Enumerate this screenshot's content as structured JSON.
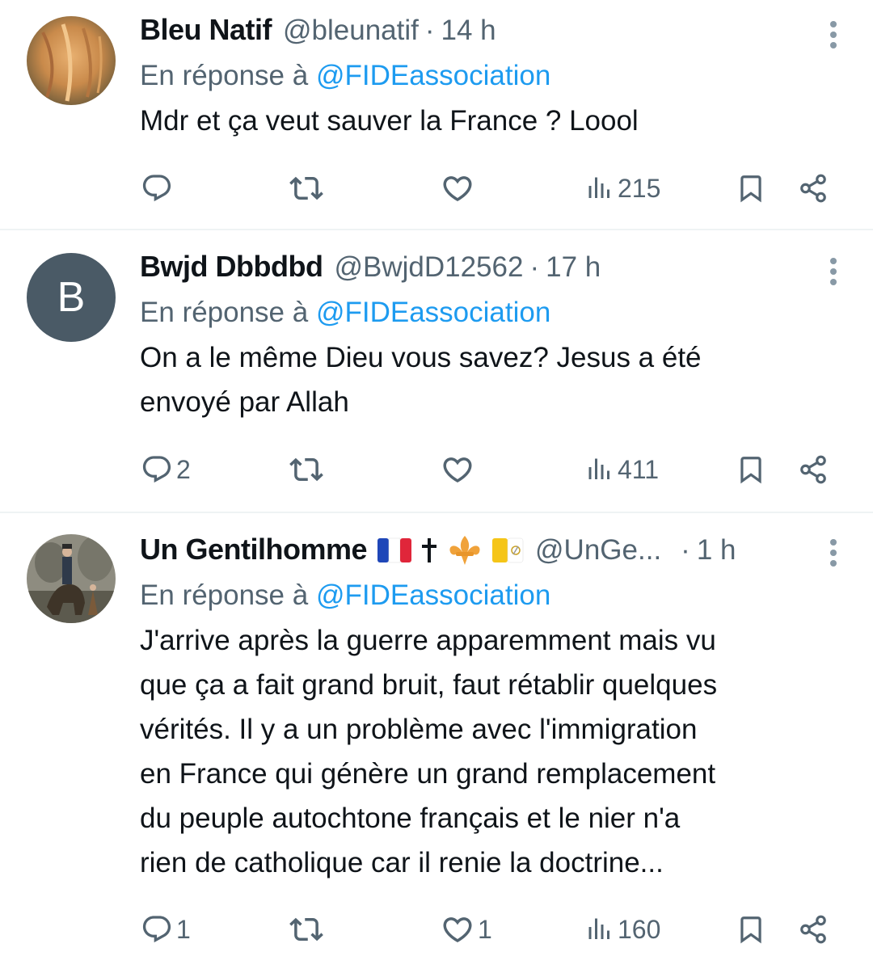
{
  "tweets": [
    {
      "name": "Bleu Natif",
      "handle": "@bleunatif",
      "dot": "·",
      "time": "14 h",
      "reply_prefix": "En réponse à",
      "reply_to": "@FIDEassociation",
      "text": "Mdr et ça veut sauver la France ? Loool",
      "replies": "",
      "retweets": "",
      "likes": "",
      "views": "215"
    },
    {
      "name": "Bwjd Dbbdbd",
      "handle": "@BwjdD12562",
      "dot": "·",
      "time": "17 h",
      "avatar_letter": "B",
      "reply_prefix": "En réponse à",
      "reply_to": "@FIDEassociation",
      "text_lines": [
        "On a le même Dieu vous savez? Jesus a été",
        "envoyé par Allah"
      ],
      "replies": "2",
      "retweets": "",
      "likes": "",
      "views": "411"
    },
    {
      "name": "Un Gentilhomme",
      "name_emojis": [
        "french-flag",
        "latin-cross",
        "fleur-de-lis",
        "vatican-flag"
      ],
      "handle": "@UnGe...",
      "dot": "·",
      "time": "1 h",
      "reply_prefix": "En réponse à",
      "reply_to": "@FIDEassociation",
      "text_lines": [
        "J'arrive après la guerre apparemment mais vu",
        "que ça a fait grand bruit, faut rétablir quelques",
        "vérités. Il y a un problème avec l'immigration",
        "en France qui génère un grand remplacement",
        "du peuple autochtone français et le nier n'a",
        "rien de catholique car il renie la doctrine..."
      ],
      "replies": "1",
      "retweets": "",
      "likes": "1",
      "views": "160"
    }
  ],
  "colors": {
    "text": "#0f1419",
    "secondary": "#536471",
    "mention": "#1d9bf0",
    "divider": "#eff3f4",
    "avatar_letter_bg": "#4a5a66"
  },
  "icons": [
    "reply-icon",
    "retweet-icon",
    "like-icon",
    "views-icon",
    "bookmark-icon",
    "share-icon",
    "more-icon"
  ]
}
